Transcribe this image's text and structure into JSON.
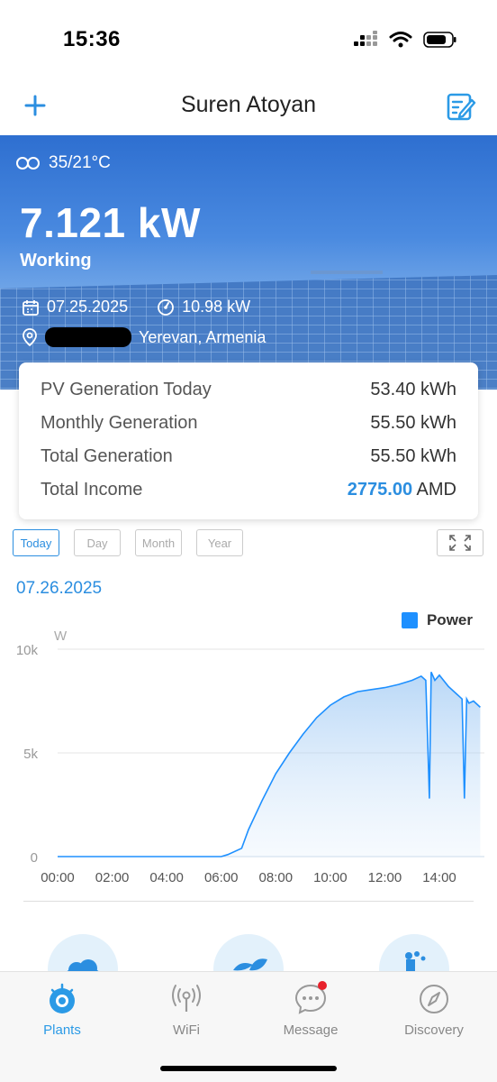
{
  "status_bar": {
    "time": "15:36"
  },
  "header": {
    "title": "Suren Atoyan"
  },
  "hero": {
    "weather": "35/21°C",
    "power": "7.121 kW",
    "status": "Working",
    "date": "07.25.2025",
    "capacity": "10.98 kW",
    "location": "Yerevan, Armenia"
  },
  "stats": [
    {
      "label": "PV Generation Today",
      "value": "53.40 kWh"
    },
    {
      "label": "Monthly Generation",
      "value": "55.50 kWh"
    },
    {
      "label": "Total Generation",
      "value": "55.50 kWh"
    }
  ],
  "income": {
    "label": "Total Income",
    "amount": "2775.00",
    "currency": "AMD"
  },
  "tabs": [
    {
      "label": "Today",
      "active": true
    },
    {
      "label": "Day",
      "active": false
    },
    {
      "label": "Month",
      "active": false
    },
    {
      "label": "Year",
      "active": false
    }
  ],
  "chart_date": "07.26.2025",
  "chart_data": {
    "type": "area",
    "ylabel": "W",
    "legend": "Power",
    "legend_position": "top-right",
    "ylim": [
      0,
      10000
    ],
    "yticks": [
      "10k",
      "5k",
      "0"
    ],
    "xticks": [
      "00:00",
      "02:00",
      "04:00",
      "06:00",
      "08:00",
      "10:00",
      "12:00",
      "14:00"
    ],
    "grid": true,
    "series": [
      {
        "name": "Power",
        "color": "#1e90ff",
        "x": [
          "00:00",
          "06:00",
          "06:15",
          "06:45",
          "07:00",
          "07:30",
          "08:00",
          "08:30",
          "09:00",
          "09:30",
          "10:00",
          "10:30",
          "11:00",
          "11:30",
          "12:00",
          "12:30",
          "13:00",
          "13:20",
          "13:30",
          "13:35",
          "13:38",
          "13:42",
          "13:50",
          "14:00",
          "14:20",
          "14:40",
          "14:50",
          "14:55",
          "15:00",
          "15:05",
          "15:15",
          "15:30"
        ],
        "y": [
          0,
          0,
          100,
          400,
          1300,
          2700,
          4000,
          5000,
          5900,
          6700,
          7300,
          7700,
          7950,
          8050,
          8150,
          8300,
          8500,
          8700,
          8500,
          5000,
          2800,
          8900,
          8500,
          8750,
          8200,
          7800,
          7600,
          2800,
          7600,
          7400,
          7500,
          7200
        ]
      }
    ]
  },
  "nav": [
    {
      "label": "Plants",
      "active": true
    },
    {
      "label": "WiFi",
      "active": false
    },
    {
      "label": "Message",
      "active": false
    },
    {
      "label": "Discovery",
      "active": false
    }
  ],
  "colors": {
    "accent": "#2b8ee0",
    "chart_line": "#1e90ff",
    "badge": "#e8212b"
  }
}
